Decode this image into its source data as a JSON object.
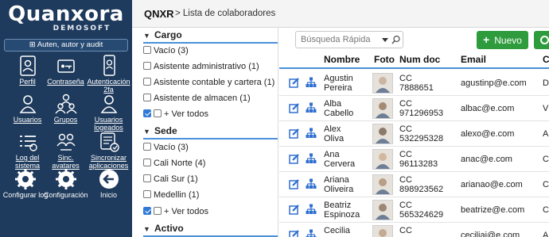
{
  "brand": {
    "name": "Quanxora",
    "sub": "DEMOSOFT"
  },
  "sidebar": {
    "section_button": "⊞ Auten, autor y audit",
    "tiles": [
      {
        "label": "Perfil",
        "icon": "profile-card-icon"
      },
      {
        "label": "Contraseña",
        "icon": "password-key-icon"
      },
      {
        "label": "Autenticación 2fa",
        "icon": "two-factor-phone-icon"
      },
      {
        "label": "Usuarios",
        "icon": "user-icon"
      },
      {
        "label": "Grupos",
        "icon": "group-icon"
      },
      {
        "label": "Usuarios logeados",
        "icon": "logged-user-icon"
      },
      {
        "label": "Log del sistema",
        "icon": "system-log-icon"
      },
      {
        "label": "Sinc. avatares",
        "icon": "sync-avatars-icon"
      },
      {
        "label": "Sincronizar aplicaciones",
        "icon": "sync-apps-icon"
      },
      {
        "label": "Configurar log",
        "icon": "gear-icon"
      },
      {
        "label": "Configuración",
        "icon": "gear-icon"
      },
      {
        "label": "Inicio",
        "icon": "back-arrow-icon"
      }
    ]
  },
  "topbar": {
    "title": "QNXR",
    "breadcrumb": "> Lista de colaboradores"
  },
  "filters": {
    "cargo": {
      "title": "Cargo",
      "items": [
        "Vacío (3)",
        "Asistente administrativo (1)",
        "Asistente contable y cartera (1)",
        "Asistente de almacen (1)"
      ],
      "toggle": "+ Ver todos"
    },
    "sede": {
      "title": "Sede",
      "items": [
        "Vacío (3)",
        "Cali Norte (4)",
        "Cali Sur (1)",
        "Medellin (1)"
      ],
      "toggle": "+ Ver todos"
    },
    "activo": {
      "title": "Activo"
    }
  },
  "toolbar": {
    "search_placeholder": "Búsqueda Rápida",
    "new_label": "Nuevo"
  },
  "table": {
    "headers": {
      "nombre": "Nombre",
      "foto": "Foto",
      "doc": "Num doc",
      "email": "Email",
      "extra": "C"
    },
    "rows": [
      {
        "n1": "Agustin",
        "n2": "Pereira",
        "d1": "CC",
        "d2": "7888651",
        "email": "agustinp@e.com",
        "extra": "D"
      },
      {
        "n1": "Alba",
        "n2": "Cabello",
        "d1": "CC",
        "d2": "971296953",
        "email": "albac@e.com",
        "extra": "V"
      },
      {
        "n1": "Alex",
        "n2": "Oliva",
        "d1": "CC",
        "d2": "532295328",
        "email": "alexo@e.com",
        "extra": "A"
      },
      {
        "n1": "Ana",
        "n2": "Cervera",
        "d1": "CC",
        "d2": "96113283",
        "email": "anac@e.com",
        "extra": "C"
      },
      {
        "n1": "Ariana",
        "n2": "Oliveira",
        "d1": "CC",
        "d2": "898923562",
        "email": "arianao@e.com",
        "extra": "C"
      },
      {
        "n1": "Beatriz",
        "n2": "Espinoza",
        "d1": "CC",
        "d2": "565324629",
        "email": "beatrize@e.com",
        "extra": "C"
      },
      {
        "n1": "Cecilia",
        "n2": "",
        "d1": "CC",
        "d2": "",
        "email": "ceciliai@e.com",
        "extra": "A"
      }
    ]
  },
  "colors": {
    "sidebar": "#1e3a5c",
    "accent": "#4a90d9",
    "action": "#2f6fd0",
    "success": "#2e9b3d"
  }
}
